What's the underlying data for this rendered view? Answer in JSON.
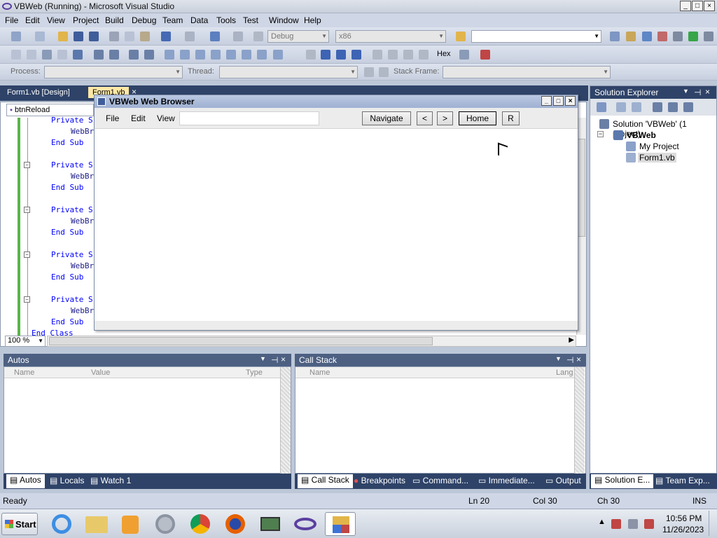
{
  "window": {
    "title": "VBWeb (Running) - Microsoft Visual Studio",
    "min": "_",
    "max": "□",
    "close": "×"
  },
  "menu": [
    "File",
    "Edit",
    "View",
    "Project",
    "Build",
    "Debug",
    "Team",
    "Data",
    "Tools",
    "Test",
    "Window",
    "Help"
  ],
  "toolbar": {
    "config": "Debug",
    "platform": "x86",
    "hex_label": "Hex"
  },
  "debugbar": {
    "process_label": "Process:",
    "thread_label": "Thread:",
    "stackframe_label": "Stack Frame:"
  },
  "doc_tabs": [
    "Form1.vb [Design]",
    "Form1.vb"
  ],
  "editor": {
    "member_combo": "btnReload",
    "lines": [
      {
        "text": "Private S",
        "indent": 2,
        "kind": "k"
      },
      {
        "text": "WebBr",
        "indent": 3,
        "kind": "n"
      },
      {
        "text": "End Sub",
        "indent": 2,
        "kind": "k"
      },
      {
        "text": "Private S",
        "indent": 2,
        "kind": "k"
      },
      {
        "text": "WebBr",
        "indent": 3,
        "kind": "n"
      },
      {
        "text": "End Sub",
        "indent": 2,
        "kind": "k"
      },
      {
        "text": "Private S",
        "indent": 2,
        "kind": "k"
      },
      {
        "text": "WebBr",
        "indent": 3,
        "kind": "n"
      },
      {
        "text": "End Sub",
        "indent": 2,
        "kind": "k"
      },
      {
        "text": "Private S",
        "indent": 2,
        "kind": "k"
      },
      {
        "text": "WebBr",
        "indent": 3,
        "kind": "n"
      },
      {
        "text": "End Sub",
        "indent": 2,
        "kind": "k"
      },
      {
        "text": "Private S",
        "indent": 2,
        "kind": "k"
      },
      {
        "text": "WebBr",
        "indent": 3,
        "kind": "n"
      },
      {
        "text": "End Sub",
        "indent": 2,
        "kind": "k"
      },
      {
        "text": "End Class",
        "indent": 1,
        "kind": "k"
      }
    ],
    "zoom": "100 %"
  },
  "browser": {
    "title": "VBWeb Web Browser",
    "menu": [
      "File",
      "Edit",
      "View"
    ],
    "url_value": "",
    "navigate": "Navigate",
    "back": "<",
    "forward": ">",
    "home": "Home",
    "reload": "R"
  },
  "solution_explorer": {
    "title": "Solution Explorer",
    "solution": "Solution 'VBWeb' (1 project)",
    "project": "VBWeb",
    "items": [
      "My Project",
      "Form1.vb"
    ]
  },
  "autos": {
    "title": "Autos",
    "columns": [
      "Name",
      "Value",
      "Type"
    ]
  },
  "callstack": {
    "title": "Call Stack",
    "columns": [
      "Name",
      "Lang"
    ]
  },
  "bottom_tabs_left": [
    "Autos",
    "Locals",
    "Watch 1"
  ],
  "bottom_tabs_right": [
    "Call Stack",
    "Breakpoints",
    "Command...",
    "Immediate...",
    "Output"
  ],
  "right_tabs": [
    "Solution E...",
    "Team Exp..."
  ],
  "status": {
    "ready": "Ready",
    "ln": "Ln 20",
    "col": "Col 30",
    "ch": "Ch 30",
    "ins": "INS"
  },
  "taskbar": {
    "start": "Start",
    "time": "10:56 PM",
    "date": "11/26/2023"
  }
}
